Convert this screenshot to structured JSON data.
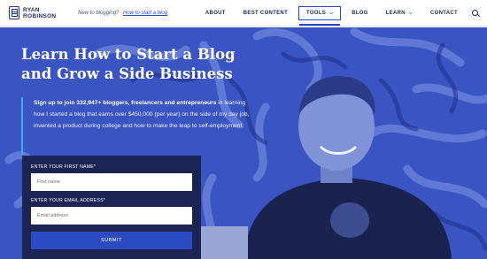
{
  "header": {
    "logo_line1": "RYAN",
    "logo_line2": "ROBINSON",
    "new_prompt": "New to blogging?",
    "new_link": "How to start a blog",
    "nav": [
      "ABOUT",
      "BEST CONTENT",
      "TOOLS",
      "BLOG",
      "LEARN",
      "CONTACT"
    ],
    "search_icon": "search-icon"
  },
  "hero": {
    "headline_line1": "Learn How to Start a Blog",
    "headline_line2": "and Grow a Side Business",
    "copy_bold": "Sign up to join 332,947+ bloggers, freelancers and entrepreneurs",
    "copy_rest": "in learning how I started a blog that earns over $450,000 (per year) on the side of my day job, invented a product during college and how to make the leap to self-employment."
  },
  "form": {
    "first_name_label": "ENTER YOUR FIRST NAME*",
    "first_name_placeholder": "First name",
    "email_label": "ENTER YOUR EMAIL ADDRESS*",
    "email_placeholder": "Email address",
    "submit_label": "SUBMIT"
  },
  "colors": {
    "hero_overlay": "#3a54c2",
    "accent": "#2b48c4",
    "form_bg": "#1c2454",
    "quote_bar": "#39b0f0"
  }
}
